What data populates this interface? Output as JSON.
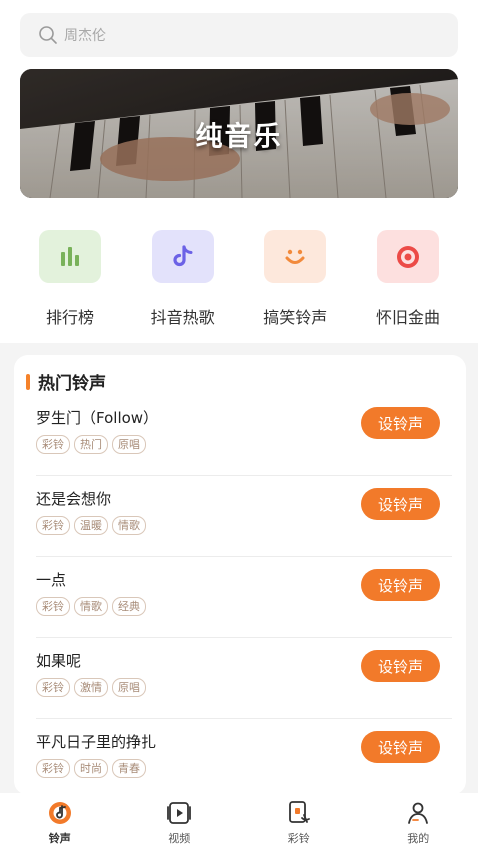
{
  "search": {
    "placeholder": "周杰伦"
  },
  "banner": {
    "title": "纯音乐"
  },
  "categories": [
    {
      "label": "排行榜",
      "icon": "chart-bars-icon",
      "bg": "#e3f2dc",
      "color": "#79b25a"
    },
    {
      "label": "抖音热歌",
      "icon": "tiktok-icon",
      "bg": "#e3e2fb",
      "color": "#6c62e6"
    },
    {
      "label": "搞笑铃声",
      "icon": "smile-icon",
      "bg": "#fde8dc",
      "color": "#f28a3c"
    },
    {
      "label": "怀旧金曲",
      "icon": "record-target-icon",
      "bg": "#fde0df",
      "color": "#ec4b47"
    }
  ],
  "hot": {
    "title": "热门铃声",
    "button_label": "设铃声",
    "songs": [
      {
        "name": "罗生门（Follow）",
        "tags": [
          "彩铃",
          "热门",
          "原唱"
        ]
      },
      {
        "name": "还是会想你",
        "tags": [
          "彩铃",
          "温暖",
          "情歌"
        ]
      },
      {
        "name": "一点",
        "tags": [
          "彩铃",
          "情歌",
          "经典"
        ]
      },
      {
        "name": "如果呢",
        "tags": [
          "彩铃",
          "激情",
          "原唱"
        ]
      },
      {
        "name": "平凡日子里的挣扎",
        "tags": [
          "彩铃",
          "时尚",
          "青春"
        ]
      }
    ]
  },
  "tabbar": {
    "items": [
      {
        "label": "铃声",
        "icon": "ringtone-music-icon",
        "active": true
      },
      {
        "label": "视频",
        "icon": "video-play-icon",
        "active": false
      },
      {
        "label": "彩铃",
        "icon": "phone-ring-icon",
        "active": false
      },
      {
        "label": "我的",
        "icon": "user-profile-icon",
        "active": false
      }
    ]
  },
  "colors": {
    "accent": "#f27a2a"
  }
}
